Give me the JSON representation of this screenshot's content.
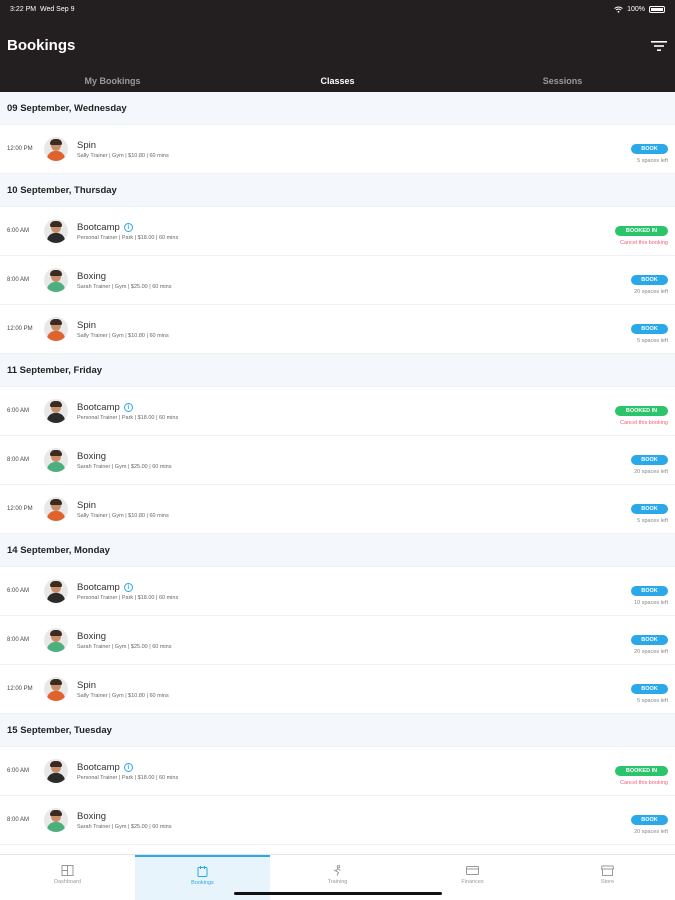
{
  "status": {
    "time": "3:22 PM",
    "date": "Wed Sep 9",
    "battery": "100%"
  },
  "header": {
    "title": "Bookings",
    "filter_icon": "filter-icon"
  },
  "tabs": [
    {
      "label": "My Bookings",
      "active": false
    },
    {
      "label": "Classes",
      "active": true
    },
    {
      "label": "Sessions",
      "active": false
    }
  ],
  "days": [
    {
      "label": "09 September, Wednesday",
      "rows": [
        {
          "time": "12:00 PM",
          "name": "Spin",
          "meta": "Sally Trainer | Gym | $10.80 | 60 mins",
          "action": "BOOK",
          "sub": "5 spaces left",
          "avatar": "f"
        }
      ]
    },
    {
      "label": "10 September, Thursday",
      "rows": [
        {
          "time": "6:00 AM",
          "name": "Bootcamp",
          "info": true,
          "meta": "Personal Trainer | Park | $18.00 | 60 mins",
          "action": "BOOKED IN",
          "sub": "Cancel this booking",
          "avatar": "m"
        },
        {
          "time": "8:00 AM",
          "name": "Boxing",
          "meta": "Sarah Trainer | Gym | $25.00 | 60 mins",
          "action": "BOOK",
          "sub": "20 spaces left",
          "avatar": "s"
        },
        {
          "time": "12:00 PM",
          "name": "Spin",
          "meta": "Sally Trainer | Gym | $10.80 | 60 mins",
          "action": "BOOK",
          "sub": "5 spaces left",
          "avatar": "f"
        }
      ]
    },
    {
      "label": "11 September, Friday",
      "rows": [
        {
          "time": "6:00 AM",
          "name": "Bootcamp",
          "info": true,
          "meta": "Personal Trainer | Park | $18.00 | 60 mins",
          "action": "BOOKED IN",
          "sub": "Cancel this booking",
          "avatar": "m"
        },
        {
          "time": "8:00 AM",
          "name": "Boxing",
          "meta": "Sarah Trainer | Gym | $25.00 | 60 mins",
          "action": "BOOK",
          "sub": "20 spaces left",
          "avatar": "s"
        },
        {
          "time": "12:00 PM",
          "name": "Spin",
          "meta": "Sally Trainer | Gym | $10.80 | 60 mins",
          "action": "BOOK",
          "sub": "5 spaces left",
          "avatar": "f"
        }
      ]
    },
    {
      "label": "14 September, Monday",
      "rows": [
        {
          "time": "6:00 AM",
          "name": "Bootcamp",
          "info": true,
          "meta": "Personal Trainer | Park | $18.00 | 60 mins",
          "action": "BOOK",
          "sub": "10 spaces left",
          "avatar": "m"
        },
        {
          "time": "8:00 AM",
          "name": "Boxing",
          "meta": "Sarah Trainer | Gym | $25.00 | 60 mins",
          "action": "BOOK",
          "sub": "20 spaces left",
          "avatar": "s"
        },
        {
          "time": "12:00 PM",
          "name": "Spin",
          "meta": "Sally Trainer | Gym | $10.80 | 60 mins",
          "action": "BOOK",
          "sub": "5 spaces left",
          "avatar": "f"
        }
      ]
    },
    {
      "label": "15 September, Tuesday",
      "rows": [
        {
          "time": "6:00 AM",
          "name": "Bootcamp",
          "info": true,
          "meta": "Personal Trainer | Park | $18.00 | 60 mins",
          "action": "BOOKED IN",
          "sub": "Cancel this booking",
          "avatar": "m"
        },
        {
          "time": "8:00 AM",
          "name": "Boxing",
          "meta": "Sarah Trainer | Gym | $25.00 | 60 mins",
          "action": "BOOK",
          "sub": "20 spaces left",
          "avatar": "s"
        }
      ]
    }
  ],
  "bottom_nav": [
    {
      "label": "Dashboard",
      "icon": "dashboard-icon",
      "active": false
    },
    {
      "label": "Bookings",
      "icon": "calendar-icon",
      "active": true
    },
    {
      "label": "Training",
      "icon": "training-icon",
      "active": false
    },
    {
      "label": "Finances",
      "icon": "card-icon",
      "active": false
    },
    {
      "label": "Store",
      "icon": "store-icon",
      "active": false
    }
  ],
  "colors": {
    "header": "#231f20",
    "book": "#2aa8e8",
    "booked": "#2cc46b",
    "cancel": "#f0607a"
  }
}
